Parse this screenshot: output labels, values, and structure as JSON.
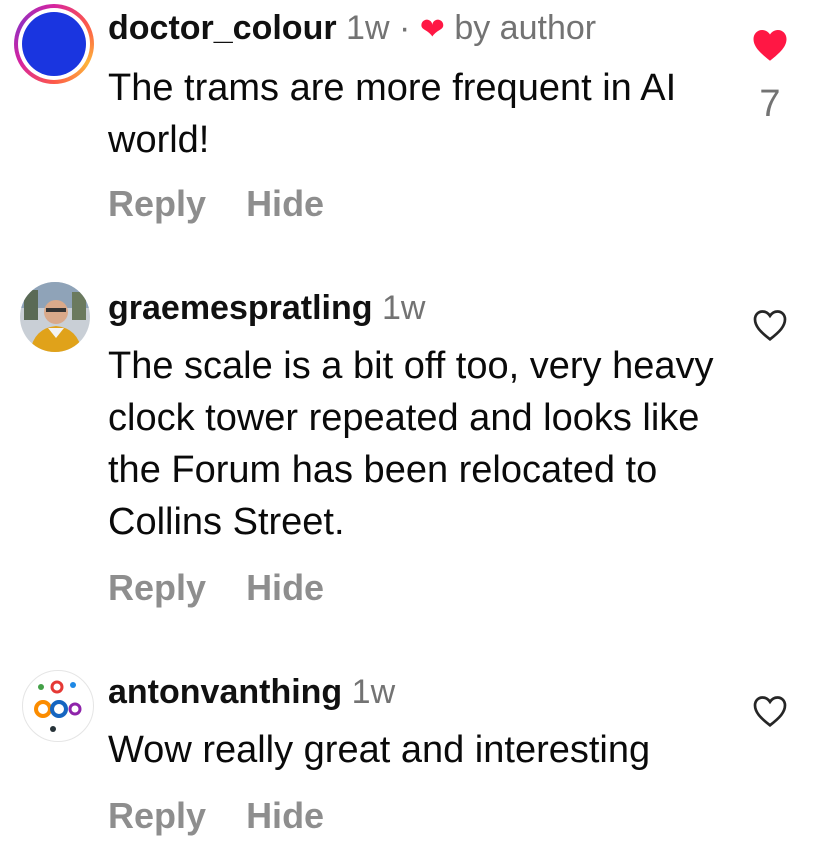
{
  "comments": [
    {
      "username": "doctor_colour",
      "time": "1w",
      "separator": "·",
      "by_author_label": "by author",
      "text": "The trams are more frequent in AI world!",
      "reply_label": "Reply",
      "hide_label": "Hide",
      "liked": true,
      "like_count": "7",
      "heart_color": "#ff1744"
    },
    {
      "username": "graemespratling",
      "time": "1w",
      "text": "The scale is a bit off too, very heavy clock tower repeated and looks like the Forum has been relocated to Collins Street.",
      "reply_label": "Reply",
      "hide_label": "Hide",
      "liked": false
    },
    {
      "username": "antonvanthing",
      "time": "1w",
      "text": "Wow really great and interesting",
      "reply_label": "Reply",
      "hide_label": "Hide",
      "liked": false
    }
  ],
  "colors": {
    "text": "#0a0a0a",
    "muted": "#737373",
    "action": "#8e8e8e",
    "like_red": "#ff1744",
    "avatar_blue": "#1a35e0"
  }
}
